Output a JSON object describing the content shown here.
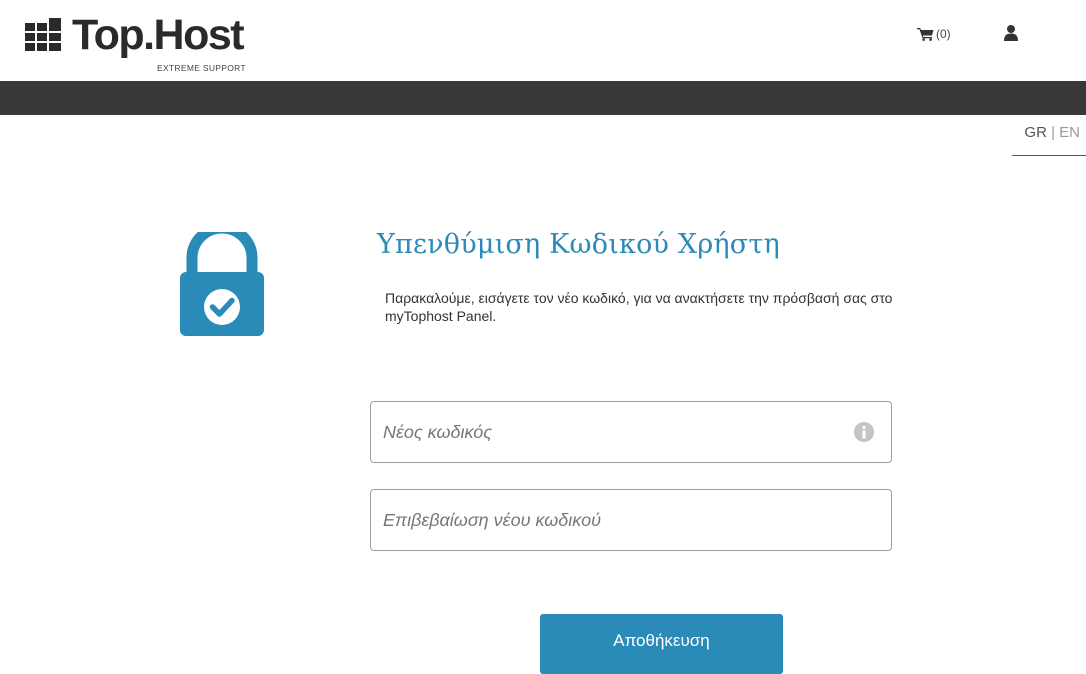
{
  "header": {
    "logo_text": "Top.Host",
    "logo_tagline": "EXTREME SUPPORT",
    "cart_count": "(0)",
    "cart_icon": "shopping-cart-icon",
    "user_icon": "user-icon"
  },
  "language": {
    "gr": "GR",
    "separator": "|",
    "en": "EN"
  },
  "form": {
    "lock_icon": "padlock-check-icon",
    "title": "Υπενθύμιση Κωδικού Χρήστη",
    "subtitle": "Παρακαλούμε, εισάγετε τον νέο κωδικό, για να ανακτήσετε την πρόσβασή σας στο myTophost Panel.",
    "new_password": {
      "placeholder": "Νέος κωδικός",
      "value": ""
    },
    "confirm_password": {
      "placeholder": "Επιβεβαίωση νέου κωδικού",
      "value": ""
    },
    "info_icon": "info-icon",
    "save_label": "Αποθήκευση"
  },
  "colors": {
    "accent": "#2a8ab8",
    "navbar": "#383838",
    "logo": "#2a2a2a"
  }
}
